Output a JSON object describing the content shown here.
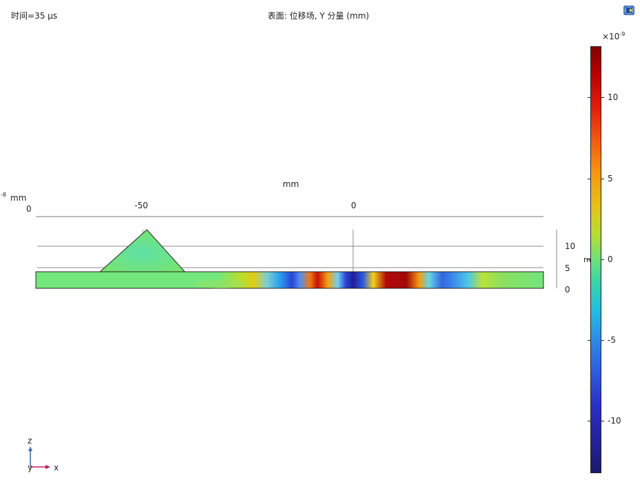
{
  "header": {
    "time_label": "时间=35 µs",
    "plot_title": "表面: 位移场, Y 分量 (mm)"
  },
  "icons": {
    "app_logo": "app-logo-icon"
  },
  "x_axis": {
    "unit": "mm",
    "ticks": [
      "-50",
      "0"
    ]
  },
  "left_axis": {
    "exponent": "-8",
    "unit": "mm",
    "tick": "0"
  },
  "z_axis": {
    "ticks": [
      "10",
      "5",
      "0"
    ],
    "unit_fragment": "m"
  },
  "colorbar": {
    "multiplier_base": "×10",
    "multiplier_exp": "-9",
    "labels": [
      "10",
      "5",
      "0",
      "-5",
      "-10"
    ],
    "range": [
      -13,
      13
    ]
  },
  "triad": {
    "z": "z",
    "y": "y",
    "x": "x"
  },
  "colors": {
    "background": "#ffffff",
    "model_neutral": "#73e67c",
    "triad_z": "#3a6fb7",
    "triad_x": "#c2185b"
  }
}
